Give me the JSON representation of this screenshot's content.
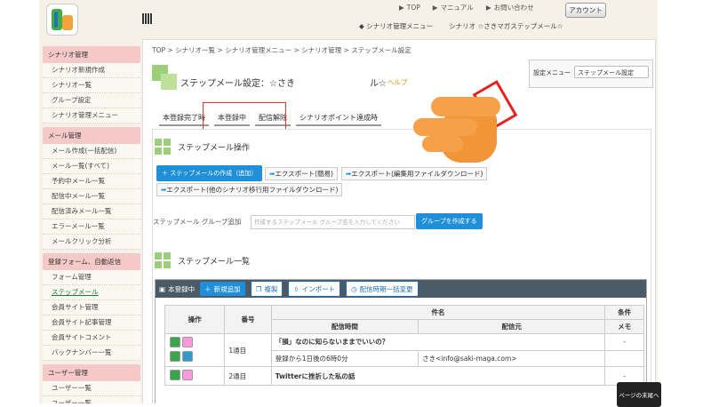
{
  "header": {
    "links": [
      "TOP",
      "マニュアル",
      "お問い合わせ"
    ],
    "account_button": "アカウント",
    "menu": [
      "シナリオ管理メニュー",
      "シナリオ ☆さきマガステップメール☆"
    ]
  },
  "sidebar": {
    "sections": [
      {
        "title": "シナリオ管理",
        "items": [
          "シナリオ新規作成",
          "シナリオ一覧",
          "グループ設定",
          "シナリオ管理メニュー"
        ]
      },
      {
        "title": "メール管理",
        "items": [
          "メール作成(一括配信)",
          "メール一覧(すべて)",
          "予約中メール一覧",
          "配信中メール一覧",
          "配信済みメール一覧",
          "エラーメール一覧",
          "メールクリック分析"
        ]
      },
      {
        "title": "登録フォーム、自動返信",
        "items": [
          "フォーム管理",
          "ステップメール",
          "会員サイト管理",
          "会員サイト記事管理",
          "会員サイトコメント",
          "バックナンバー一覧"
        ]
      },
      {
        "title": "ユーザー管理",
        "items": [
          "ユーザー一覧",
          "ユーザー一覧"
        ]
      }
    ]
  },
  "breadcrumb": "TOP > シナリオ一覧 > シナリオ管理メニュー > シナリオ管理 > ステップメール設定",
  "page_title": "ステップメール設定：☆さき",
  "page_title_suffix": "ル☆",
  "help": "ヘルプ",
  "setting_menu": {
    "label": "設定メニュー",
    "value": "ステップメール設定"
  },
  "tabs": [
    "本登録完了時",
    "本登録中",
    "配信解除",
    "シナリオポイント達成時"
  ],
  "ops_section": {
    "title": "ステップメール操作",
    "create_button": "＋ ステップメールの作成（追加）",
    "exports": [
      "エクスポート(簡易)",
      "エクスポート(編集用ファイルダウンロード)",
      "エクスポート(他のシナリオ移行用ファイルダウンロード)"
    ],
    "group_label": "ステップメール グループ追加",
    "group_placeholder": "作成するステップメール グループ名を入力してください",
    "group_button": "グループを作成する"
  },
  "list_section": {
    "title": "ステップメール一覧",
    "bar_title": "本登録中",
    "buttons": [
      "新規追加",
      "複製",
      "インポート",
      "配信時期一括変更"
    ],
    "headers": {
      "op": "操作",
      "num": "番号",
      "subject": "件名",
      "time": "配信時間",
      "from": "配信元",
      "cond": "条件",
      "memo": "メモ"
    },
    "rows": [
      {
        "num": "1通目",
        "subject": "「損」なのに知らないままでいいの？",
        "time": "登録から1日後の6時0分",
        "from": "さき<info@saki-maga.com>",
        "cond": "-"
      },
      {
        "num": "2通目",
        "subject": "Twitterに挫折した私の話",
        "time": "",
        "from": "",
        "cond": "-"
      }
    ]
  },
  "page_tip": "ページの末尾へ"
}
